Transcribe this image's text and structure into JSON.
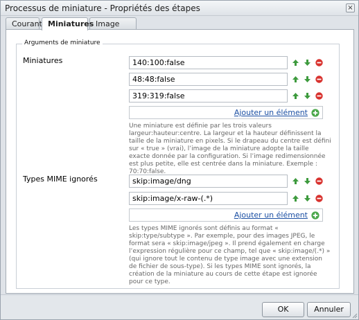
{
  "dialog": {
    "title": "Processus de miniature - Propriétés des étapes",
    "close_glyph": "×"
  },
  "tabs": [
    {
      "label": "Courant",
      "active": false
    },
    {
      "label": "Miniatures",
      "active": true
    },
    {
      "label": "Image Web",
      "active": false
    }
  ],
  "fieldset": {
    "legend": "Arguments de miniature"
  },
  "thumbnails": {
    "label": "Miniatures",
    "values": [
      "140:100:false",
      "48:48:false",
      "319:319:false"
    ],
    "add_label": "Ajouter un élément",
    "help": "Une miniature est définie par les trois valeurs largeur:hauteur:centre. La largeur et la hauteur définissent la taille de la miniature en pixels. Si le drapeau du centre est défini sur « true » (vrai), l’image de la miniature adopte la taille exacte donnée par la configuration. Si l’image redimensionnée est plus petite, elle est centrée dans la miniature. Exemple : 70:70:false."
  },
  "mime": {
    "label": "Types MIME ignorés",
    "values": [
      "skip:image/dng",
      "skip:image/x-raw-(.*)"
    ],
    "add_label": "Ajouter un élément",
    "help": "Les types MIME ignorés sont définis au format « skip:type/subtype ». Par exemple, pour des images JPEG, le format sera « skip:image/jpeg ». Il prend également en charge l’expression régulière pour ce champ, tel que « skip:image/(.*) » (qui ignore tout le contenu de type image avec une extension de fichier de sous-type). Si les types MIME sont ignorés, la création de la miniature au cours de cette étape est ignorée pour ce type."
  },
  "buttons": {
    "ok": "OK",
    "cancel": "Annuler"
  },
  "colors": {
    "up_arrow": "#3d9a3d",
    "down_arrow": "#3d9a3d",
    "remove": "#d8322e",
    "add": "#4ca84c",
    "link": "#1b4fa3"
  },
  "icons": [
    "arrow-up-icon",
    "arrow-down-icon",
    "remove-icon",
    "add-icon",
    "close-icon",
    "resize-grip-icon"
  ]
}
